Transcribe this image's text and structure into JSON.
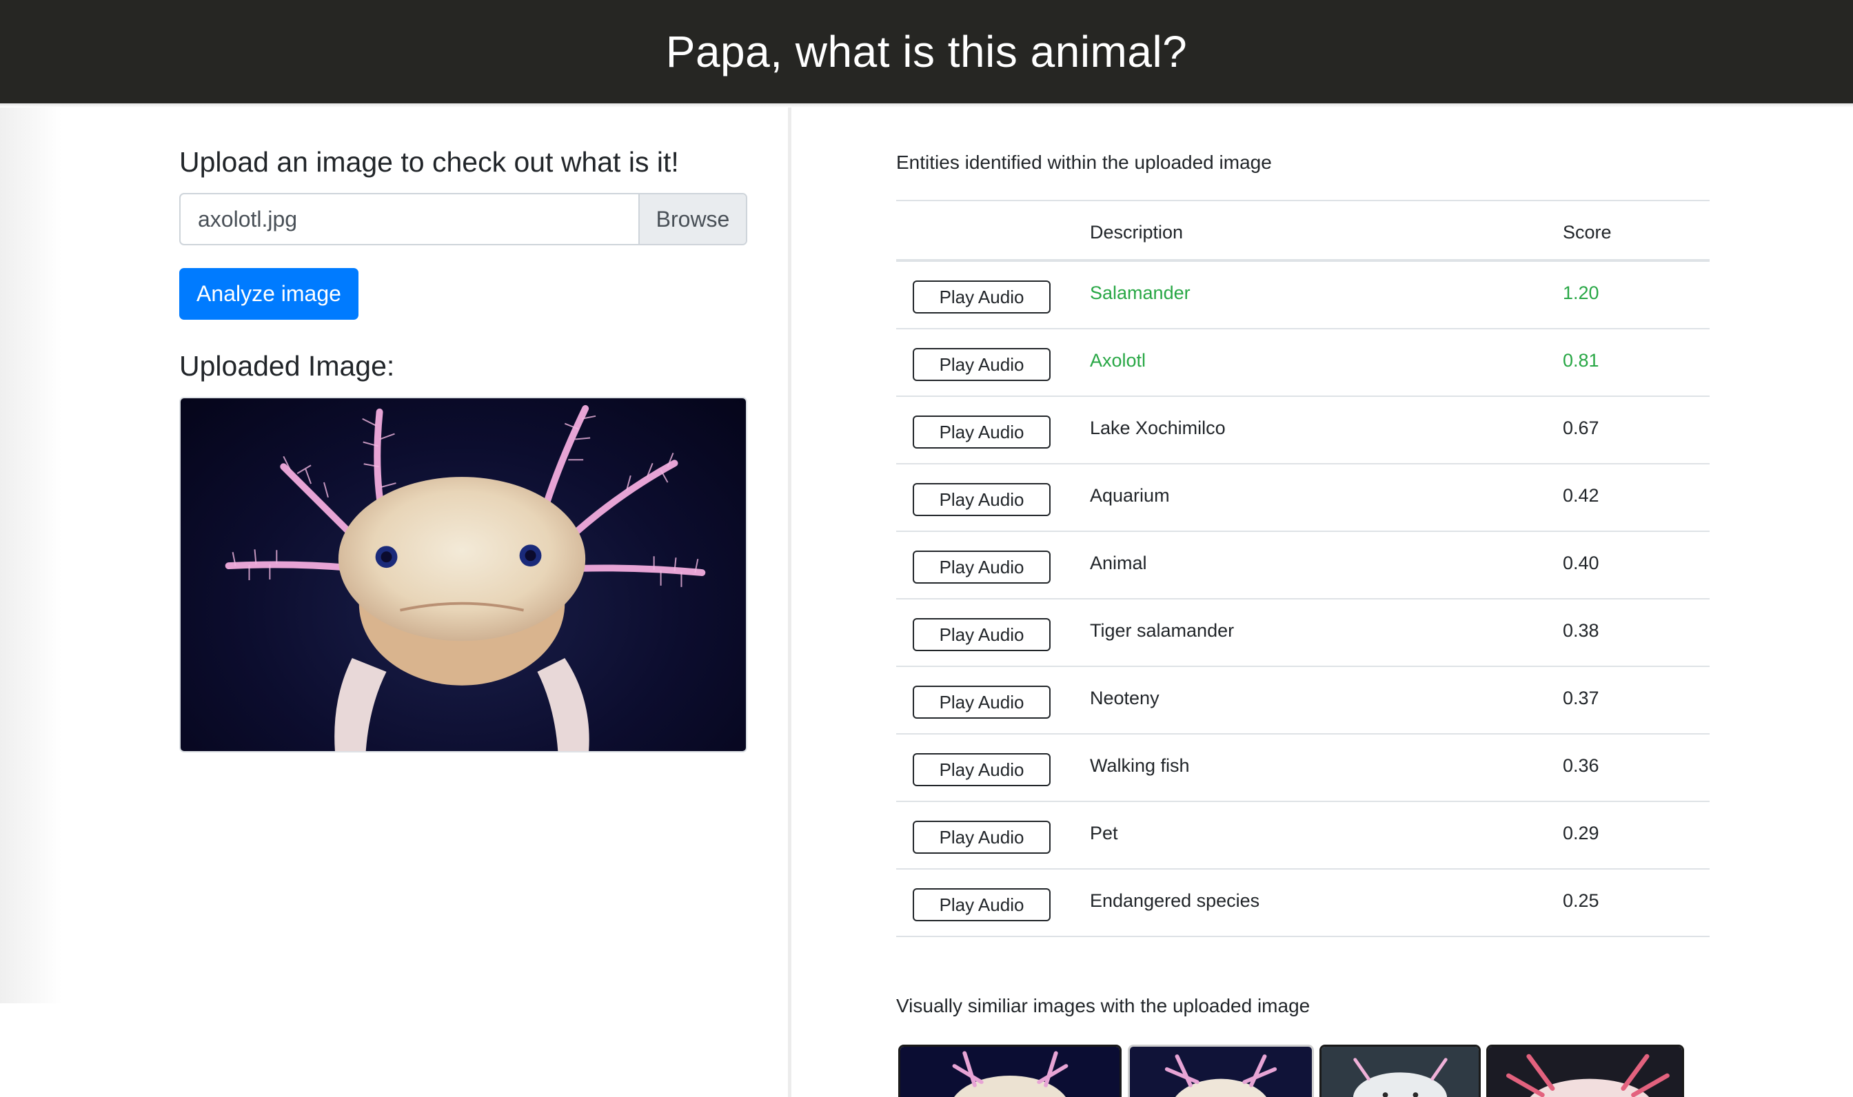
{
  "header": {
    "title": "Papa, what is this animal?"
  },
  "upload": {
    "heading": "Upload an image to check out what is it!",
    "file_name": "axolotl.jpg",
    "browse_label": "Browse",
    "analyze_label": "Analyze image",
    "uploaded_heading": "Uploaded Image:"
  },
  "results": {
    "heading": "Entities identified within the uploaded image",
    "columns": {
      "action": "",
      "description": "Description",
      "score": "Score"
    },
    "play_label": "Play Audio",
    "rows": [
      {
        "description": "Salamander",
        "score": "1.20",
        "highlight": true
      },
      {
        "description": "Axolotl",
        "score": "0.81",
        "highlight": true
      },
      {
        "description": "Lake Xochimilco",
        "score": "0.67",
        "highlight": false
      },
      {
        "description": "Aquarium",
        "score": "0.42",
        "highlight": false
      },
      {
        "description": "Animal",
        "score": "0.40",
        "highlight": false
      },
      {
        "description": "Tiger salamander",
        "score": "0.38",
        "highlight": false
      },
      {
        "description": "Neoteny",
        "score": "0.37",
        "highlight": false
      },
      {
        "description": "Walking fish",
        "score": "0.36",
        "highlight": false
      },
      {
        "description": "Pet",
        "score": "0.29",
        "highlight": false
      },
      {
        "description": "Endangered species",
        "score": "0.25",
        "highlight": false
      }
    ]
  },
  "similar": {
    "heading": "Visually similiar images with the uploaded image"
  },
  "colors": {
    "header_bg": "#262623",
    "primary": "#007bff",
    "match": "#28a745"
  }
}
